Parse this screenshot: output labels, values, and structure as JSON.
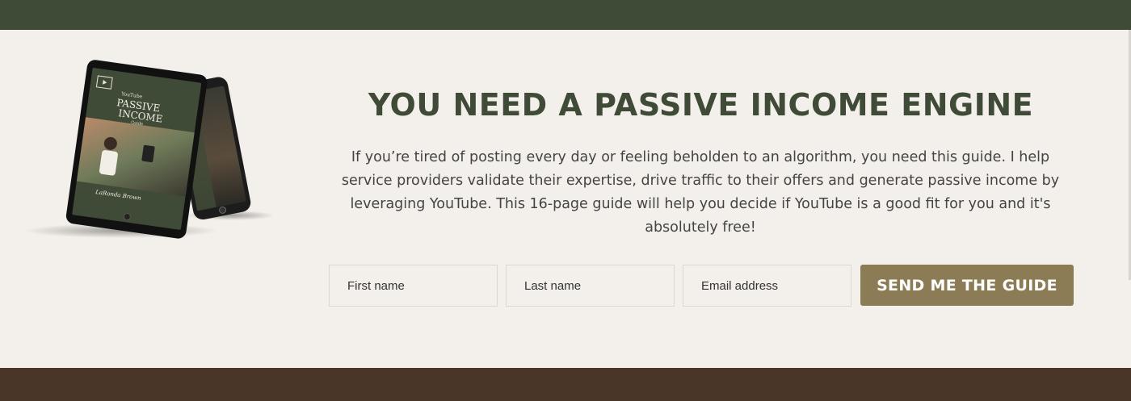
{
  "colors": {
    "top_band": "#3f4a37",
    "bottom_band": "#4a3628",
    "background": "#f3f0eb",
    "headline": "#3f4a37",
    "button": "#8c7c55"
  },
  "mockup": {
    "cover_small": "YouTube",
    "cover_title_1": "PASSIVE",
    "cover_title_2": "INCOME",
    "cover_sub": "Guide",
    "author": "LaRonda Brown"
  },
  "hero": {
    "headline": "YOU NEED A PASSIVE INCOME ENGINE",
    "body": "If you’re tired of posting every day or feeling beholden to an algorithm, you need this guide. I help service providers validate their expertise, drive traffic to their offers and generate passive income by leveraging YouTube. This 16-page guide will help you decide if YouTube is a good fit for you and it's absolutely free!"
  },
  "form": {
    "first_name_placeholder": "First name",
    "last_name_placeholder": "Last name",
    "email_placeholder": "Email address",
    "submit_label": "SEND ME THE GUIDE"
  }
}
